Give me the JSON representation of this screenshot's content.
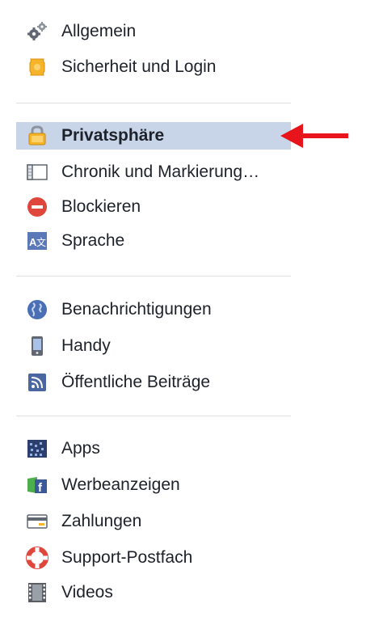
{
  "settings_menu": {
    "items": [
      {
        "label": "Allgemein",
        "icon": "gear-icon"
      },
      {
        "label": "Sicherheit und Login",
        "icon": "badge-icon"
      },
      {
        "label": "Privatsphäre",
        "icon": "lock-icon",
        "selected": true
      },
      {
        "label": "Chronik und Markierung…",
        "icon": "timeline-icon"
      },
      {
        "label": "Blockieren",
        "icon": "block-icon"
      },
      {
        "label": "Sprache",
        "icon": "language-icon"
      },
      {
        "label": "Benachrichtigungen",
        "icon": "globe-icon"
      },
      {
        "label": "Handy",
        "icon": "mobile-phone-icon"
      },
      {
        "label": "Öffentliche Beiträge",
        "icon": "rss-icon"
      },
      {
        "label": "Apps",
        "icon": "apps-icon"
      },
      {
        "label": "Werbeanzeigen",
        "icon": "ads-icon"
      },
      {
        "label": "Zahlungen",
        "icon": "credit-card-icon"
      },
      {
        "label": "Support-Postfach",
        "icon": "lifebuoy-icon"
      },
      {
        "label": "Videos",
        "icon": "film-icon"
      }
    ]
  },
  "colors": {
    "selected_background": "#c8d4e8",
    "annotation_arrow": "#e8141c",
    "divider": "#dddfe2",
    "text": "#1d2129"
  }
}
